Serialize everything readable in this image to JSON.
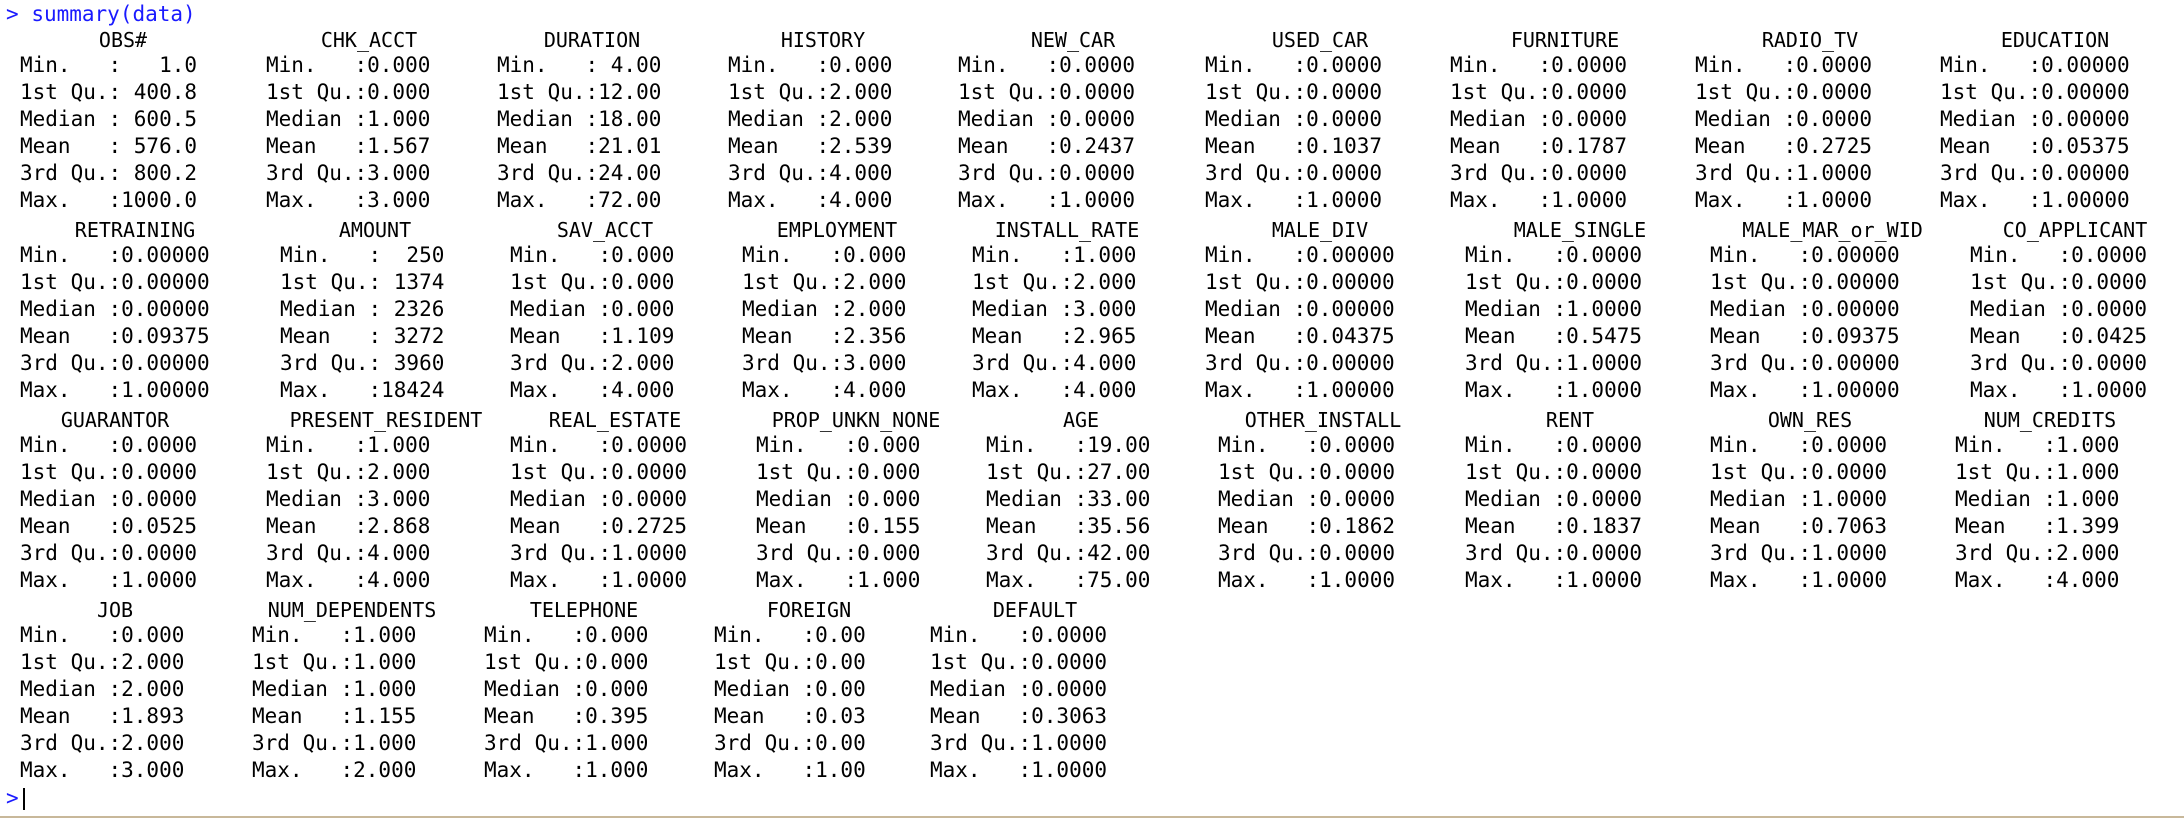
{
  "console": {
    "command_prompt": ">",
    "command": "summary(data)",
    "end_prompt": ">"
  },
  "blocks": [
    {
      "columns": [
        {
          "name": "OBS#",
          "stats": [
            "Min.   :   1.0",
            "1st Qu.: 400.8",
            "Median : 600.5",
            "Mean   : 576.0",
            "3rd Qu.: 800.2",
            "Max.   :1000.0"
          ]
        },
        {
          "name": "CHK_ACCT",
          "stats": [
            "Min.   :0.000",
            "1st Qu.:0.000",
            "Median :1.000",
            "Mean   :1.567",
            "3rd Qu.:3.000",
            "Max.   :3.000"
          ]
        },
        {
          "name": "DURATION",
          "stats": [
            "Min.   : 4.00",
            "1st Qu.:12.00",
            "Median :18.00",
            "Mean   :21.01",
            "3rd Qu.:24.00",
            "Max.   :72.00"
          ]
        },
        {
          "name": "HISTORY",
          "stats": [
            "Min.   :0.000",
            "1st Qu.:2.000",
            "Median :2.000",
            "Mean   :2.539",
            "3rd Qu.:4.000",
            "Max.   :4.000"
          ]
        },
        {
          "name": "NEW_CAR",
          "stats": [
            "Min.   :0.0000",
            "1st Qu.:0.0000",
            "Median :0.0000",
            "Mean   :0.2437",
            "3rd Qu.:0.0000",
            "Max.   :1.0000"
          ]
        },
        {
          "name": "USED_CAR",
          "stats": [
            "Min.   :0.0000",
            "1st Qu.:0.0000",
            "Median :0.0000",
            "Mean   :0.1037",
            "3rd Qu.:0.0000",
            "Max.   :1.0000"
          ]
        },
        {
          "name": "FURNITURE",
          "stats": [
            "Min.   :0.0000",
            "1st Qu.:0.0000",
            "Median :0.0000",
            "Mean   :0.1787",
            "3rd Qu.:0.0000",
            "Max.   :1.0000"
          ]
        },
        {
          "name": "RADIO_TV",
          "stats": [
            "Min.   :0.0000",
            "1st Qu.:0.0000",
            "Median :0.0000",
            "Mean   :0.2725",
            "3rd Qu.:1.0000",
            "Max.   :1.0000"
          ]
        },
        {
          "name": "EDUCATION",
          "stats": [
            "Min.   :0.00000",
            "1st Qu.:0.00000",
            "Median :0.00000",
            "Mean   :0.05375",
            "3rd Qu.:0.00000",
            "Max.   :1.00000"
          ]
        }
      ]
    },
    {
      "columns": [
        {
          "name": "RETRAINING",
          "stats": [
            "Min.   :0.00000",
            "1st Qu.:0.00000",
            "Median :0.00000",
            "Mean   :0.09375",
            "3rd Qu.:0.00000",
            "Max.   :1.00000"
          ]
        },
        {
          "name": "AMOUNT",
          "stats": [
            "Min.   :  250",
            "1st Qu.: 1374",
            "Median : 2326",
            "Mean   : 3272",
            "3rd Qu.: 3960",
            "Max.   :18424"
          ]
        },
        {
          "name": "SAV_ACCT",
          "stats": [
            "Min.   :0.000",
            "1st Qu.:0.000",
            "Median :0.000",
            "Mean   :1.109",
            "3rd Qu.:2.000",
            "Max.   :4.000"
          ]
        },
        {
          "name": "EMPLOYMENT",
          "stats": [
            "Min.   :0.000",
            "1st Qu.:2.000",
            "Median :2.000",
            "Mean   :2.356",
            "3rd Qu.:3.000",
            "Max.   :4.000"
          ]
        },
        {
          "name": "INSTALL_RATE",
          "stats": [
            "Min.   :1.000",
            "1st Qu.:2.000",
            "Median :3.000",
            "Mean   :2.965",
            "3rd Qu.:4.000",
            "Max.   :4.000"
          ]
        },
        {
          "name": "MALE_DIV",
          "stats": [
            "Min.   :0.00000",
            "1st Qu.:0.00000",
            "Median :0.00000",
            "Mean   :0.04375",
            "3rd Qu.:0.00000",
            "Max.   :1.00000"
          ]
        },
        {
          "name": "MALE_SINGLE",
          "stats": [
            "Min.   :0.0000",
            "1st Qu.:0.0000",
            "Median :1.0000",
            "Mean   :0.5475",
            "3rd Qu.:1.0000",
            "Max.   :1.0000"
          ]
        },
        {
          "name": "MALE_MAR_or_WID",
          "stats": [
            "Min.   :0.00000",
            "1st Qu.:0.00000",
            "Median :0.00000",
            "Mean   :0.09375",
            "3rd Qu.:0.00000",
            "Max.   :1.00000"
          ]
        },
        {
          "name": "CO_APPLICANT",
          "stats": [
            "Min.   :0.0000",
            "1st Qu.:0.0000",
            "Median :0.0000",
            "Mean   :0.0425",
            "3rd Qu.:0.0000",
            "Max.   :1.0000"
          ]
        }
      ]
    },
    {
      "columns": [
        {
          "name": "GUARANTOR",
          "stats": [
            "Min.   :0.0000",
            "1st Qu.:0.0000",
            "Median :0.0000",
            "Mean   :0.0525",
            "3rd Qu.:0.0000",
            "Max.   :1.0000"
          ]
        },
        {
          "name": "PRESENT_RESIDENT",
          "stats": [
            "Min.   :1.000",
            "1st Qu.:2.000",
            "Median :3.000",
            "Mean   :2.868",
            "3rd Qu.:4.000",
            "Max.   :4.000"
          ]
        },
        {
          "name": "REAL_ESTATE",
          "stats": [
            "Min.   :0.0000",
            "1st Qu.:0.0000",
            "Median :0.0000",
            "Mean   :0.2725",
            "3rd Qu.:1.0000",
            "Max.   :1.0000"
          ]
        },
        {
          "name": "PROP_UNKN_NONE",
          "stats": [
            "Min.   :0.000",
            "1st Qu.:0.000",
            "Median :0.000",
            "Mean   :0.155",
            "3rd Qu.:0.000",
            "Max.   :1.000"
          ]
        },
        {
          "name": "AGE",
          "stats": [
            "Min.   :19.00",
            "1st Qu.:27.00",
            "Median :33.00",
            "Mean   :35.56",
            "3rd Qu.:42.00",
            "Max.   :75.00"
          ]
        },
        {
          "name": "OTHER_INSTALL",
          "stats": [
            "Min.   :0.0000",
            "1st Qu.:0.0000",
            "Median :0.0000",
            "Mean   :0.1862",
            "3rd Qu.:0.0000",
            "Max.   :1.0000"
          ]
        },
        {
          "name": "RENT",
          "stats": [
            "Min.   :0.0000",
            "1st Qu.:0.0000",
            "Median :0.0000",
            "Mean   :0.1837",
            "3rd Qu.:0.0000",
            "Max.   :1.0000"
          ]
        },
        {
          "name": "OWN_RES",
          "stats": [
            "Min.   :0.0000",
            "1st Qu.:0.0000",
            "Median :1.0000",
            "Mean   :0.7063",
            "3rd Qu.:1.0000",
            "Max.   :1.0000"
          ]
        },
        {
          "name": "NUM_CREDITS",
          "stats": [
            "Min.   :1.000",
            "1st Qu.:1.000",
            "Median :1.000",
            "Mean   :1.399",
            "3rd Qu.:2.000",
            "Max.   :4.000"
          ]
        }
      ]
    },
    {
      "columns": [
        {
          "name": "JOB",
          "stats": [
            "Min.   :0.000",
            "1st Qu.:2.000",
            "Median :2.000",
            "Mean   :1.893",
            "3rd Qu.:2.000",
            "Max.   :3.000"
          ]
        },
        {
          "name": "NUM_DEPENDENTS",
          "stats": [
            "Min.   :1.000",
            "1st Qu.:1.000",
            "Median :1.000",
            "Mean   :1.155",
            "3rd Qu.:1.000",
            "Max.   :2.000"
          ]
        },
        {
          "name": "TELEPHONE",
          "stats": [
            "Min.   :0.000",
            "1st Qu.:0.000",
            "Median :0.000",
            "Mean   :0.395",
            "3rd Qu.:1.000",
            "Max.   :1.000"
          ]
        },
        {
          "name": "FOREIGN",
          "stats": [
            "Min.   :0.00",
            "1st Qu.:0.00",
            "Median :0.00",
            "Mean   :0.03",
            "3rd Qu.:0.00",
            "Max.   :1.00"
          ]
        },
        {
          "name": "DEFAULT",
          "stats": [
            "Min.   :0.0000",
            "1st Qu.:0.0000",
            "Median :0.0000",
            "Mean   :0.3063",
            "3rd Qu.:1.0000",
            "Max.   :1.0000"
          ]
        }
      ]
    }
  ]
}
